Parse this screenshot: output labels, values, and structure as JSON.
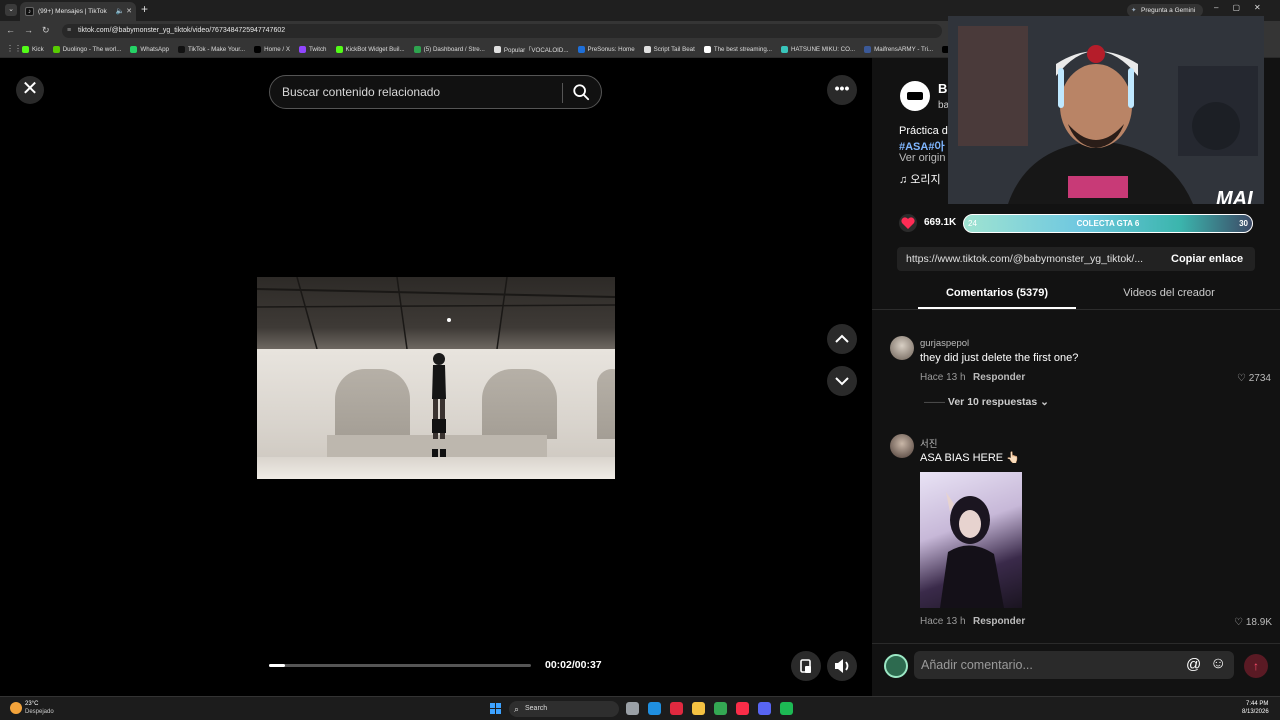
{
  "browser": {
    "tab_title": "(99+) Mensajes | TikTok",
    "tab_favicon": "tiktok-icon",
    "url": "tiktok.com/@babymonster_yg_tiktok/video/7673484725947747602",
    "gemini_button": "Pregunta a Gemini",
    "bookmarks": [
      {
        "label": "Kick",
        "color": "#53fc18"
      },
      {
        "label": "Duolingo - The worl...",
        "color": "#58cc02"
      },
      {
        "label": "WhatsApp",
        "color": "#25d366"
      },
      {
        "label": "TikTok - Make Your...",
        "color": "#111111"
      },
      {
        "label": "Home / X",
        "color": "#000000"
      },
      {
        "label": "Twitch",
        "color": "#9146ff"
      },
      {
        "label": "KickBot Widget Buil...",
        "color": "#53fc18"
      },
      {
        "label": "(5) Dashboard / Stre...",
        "color": "#2ea44f"
      },
      {
        "label": "Popular「VOCALOID...",
        "color": "#e0e0e0"
      },
      {
        "label": "PreSonus: Home",
        "color": "#1e6fd9"
      },
      {
        "label": "Script Tail Beat",
        "color": "#e0e0e0"
      },
      {
        "label": "The best streaming...",
        "color": "#ffffff"
      },
      {
        "label": "HATSUNE MIKU: CO...",
        "color": "#39c5bb"
      },
      {
        "label": "MaifrensARMY - Tri...",
        "color": "#3b5998"
      },
      {
        "label": "Inicio",
        "color": "#000000"
      }
    ]
  },
  "search": {
    "placeholder": "Buscar contenido relacionado"
  },
  "player": {
    "time": "00:02/00:37",
    "progress": 0.06
  },
  "creator": {
    "name": "B",
    "handle": "ba",
    "description": "Práctica d",
    "tags": "#ASA#아",
    "see_original": "Ver origin",
    "music": "♫  오리지"
  },
  "stats": {
    "likes": "669.1K"
  },
  "share": {
    "link": "https://www.tiktok.com/@babymonster_yg_tiktok/...",
    "copy_label": "Copiar enlace"
  },
  "tabs": {
    "comments": "Comentarios (5379)",
    "creator_videos": "Videos del creador"
  },
  "comments": [
    {
      "user": "gurjaspepol",
      "text": "they did just delete the first one?",
      "time": "Hace 13 h",
      "reply": "Responder",
      "likes": "2734",
      "view_replies": "Ver 10 respuestas"
    },
    {
      "user": "서진",
      "text": "ASA BIAS HERE 👆🏻",
      "time": "Hace 13 h",
      "reply": "Responder",
      "likes": "18.9K"
    }
  ],
  "comment_input": {
    "placeholder": "Añadir comentario..."
  },
  "overlay": {
    "gta_left": "24",
    "gta_text": "COLECTA GTA 6",
    "gta_right": "30",
    "cam_logo": "MAI"
  },
  "taskbar": {
    "weather_temp": "23°C",
    "weather_desc": "Despejado",
    "search": "Search",
    "time": "7:44 PM",
    "date": "8/13/2026",
    "apps": [
      {
        "name": "task-view",
        "color": "#9aa0a6"
      },
      {
        "name": "edge",
        "color": "#1f8fe0"
      },
      {
        "name": "opera",
        "color": "#e0293f"
      },
      {
        "name": "file-explorer",
        "color": "#f5c242"
      },
      {
        "name": "chrome",
        "color": "#34a853"
      },
      {
        "name": "music",
        "color": "#fa2d48"
      },
      {
        "name": "discord",
        "color": "#5865f2"
      },
      {
        "name": "spotify",
        "color": "#1db954"
      }
    ]
  },
  "colors": {
    "accent": "#fe2c55",
    "link": "#7fb6ff"
  }
}
